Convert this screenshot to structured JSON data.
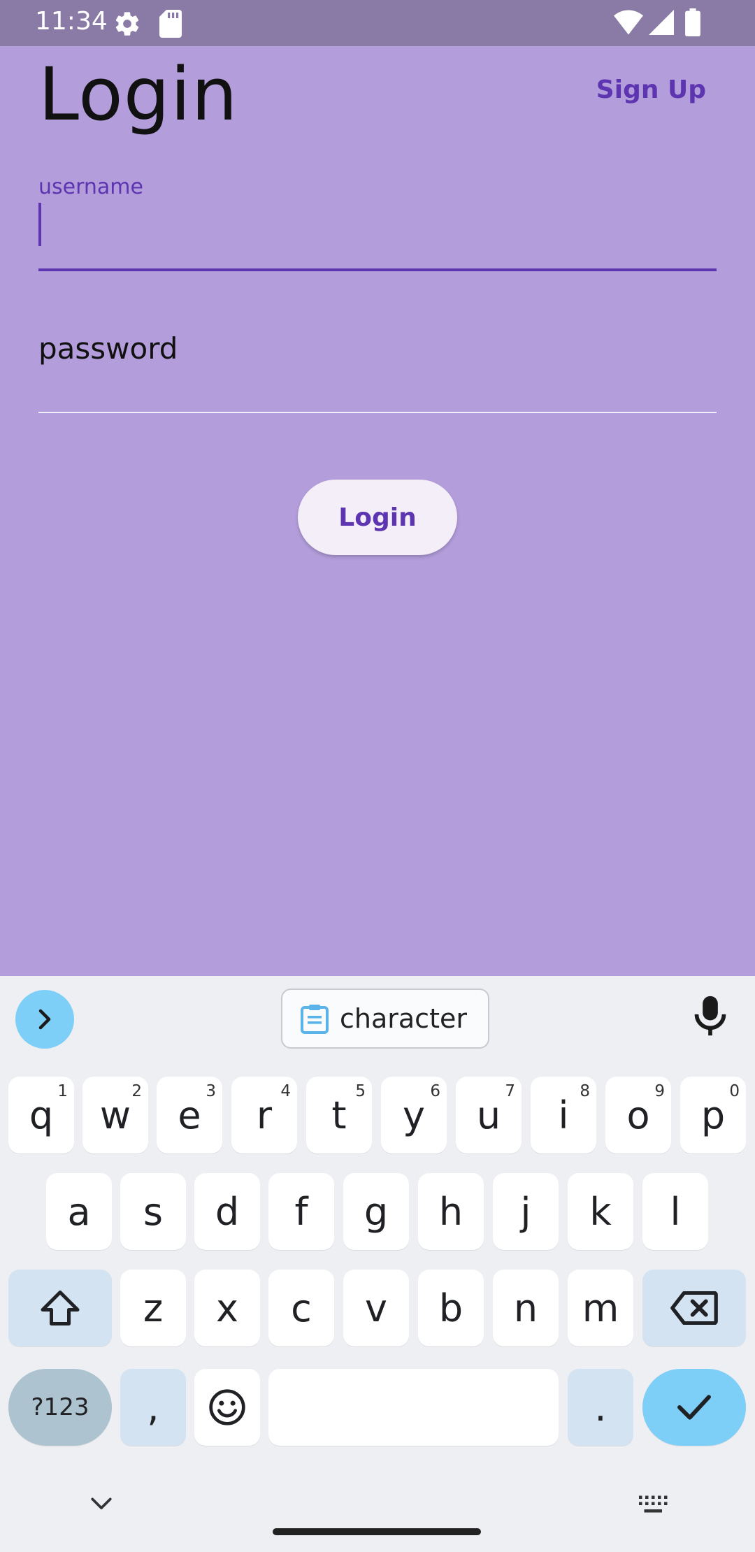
{
  "status_bar": {
    "time": "11:34",
    "icons": [
      "settings-gear-icon",
      "sd-card-icon",
      "wifi-icon",
      "cell-signal-icon",
      "battery-icon"
    ]
  },
  "app": {
    "title": "Login",
    "sign_up_label": "Sign Up",
    "username": {
      "label": "username",
      "value": ""
    },
    "password": {
      "label": "password",
      "value": ""
    },
    "login_button_label": "Login",
    "accent_color": "#5e35b1",
    "background_color": "#b39ddb"
  },
  "keyboard": {
    "suggestion": "character",
    "row1": [
      {
        "key": "q",
        "hint": "1"
      },
      {
        "key": "w",
        "hint": "2"
      },
      {
        "key": "e",
        "hint": "3"
      },
      {
        "key": "r",
        "hint": "4"
      },
      {
        "key": "t",
        "hint": "5"
      },
      {
        "key": "y",
        "hint": "6"
      },
      {
        "key": "u",
        "hint": "7"
      },
      {
        "key": "i",
        "hint": "8"
      },
      {
        "key": "o",
        "hint": "9"
      },
      {
        "key": "p",
        "hint": "0"
      }
    ],
    "row2": [
      "a",
      "s",
      "d",
      "f",
      "g",
      "h",
      "j",
      "k",
      "l"
    ],
    "row3": [
      "z",
      "x",
      "c",
      "v",
      "b",
      "n",
      "m"
    ],
    "row4": {
      "symbols": "?123",
      "comma": ",",
      "period": "."
    }
  }
}
